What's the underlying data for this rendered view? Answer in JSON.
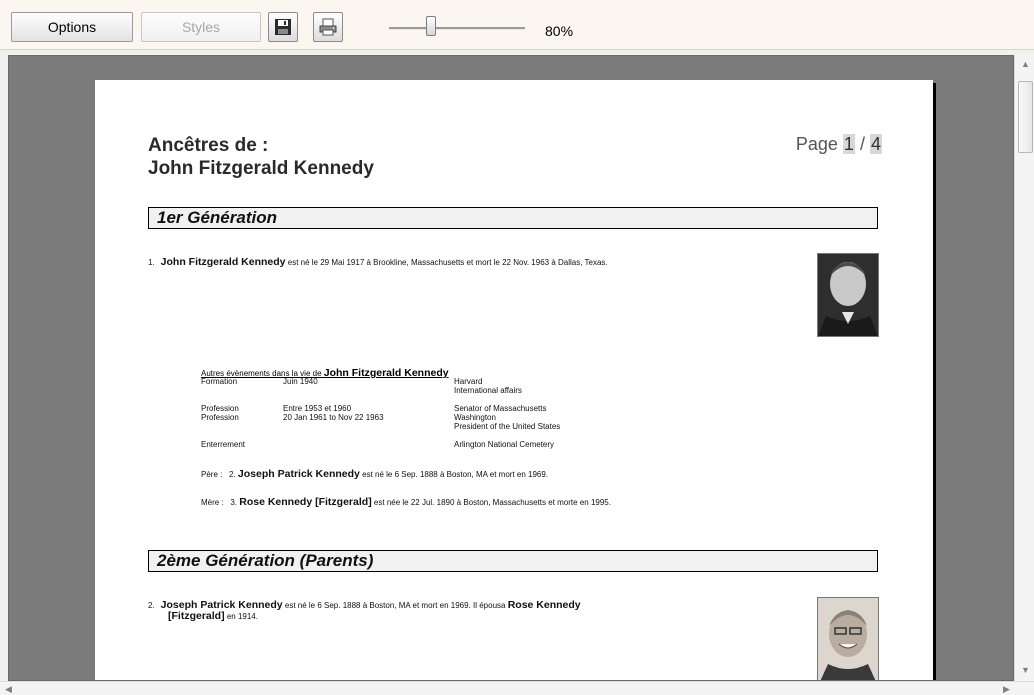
{
  "toolbar": {
    "options_label": "Options",
    "styles_label": "Styles",
    "zoom_value": "80%"
  },
  "document": {
    "title_line1": "Ancêtres de :",
    "title_line2": "John Fitzgerald Kennedy",
    "page_prefix": "Page",
    "page_current": "1",
    "page_sep": "/",
    "page_total": "4",
    "gen1_heading": "1er Génération",
    "gen2_heading": "2ème Génération (Parents)",
    "entry1": {
      "num": "1.",
      "name": "John Fitzgerald Kennedy",
      "text": "est né le 29 Mai 1917 à Brookline, Massachusetts et mort le 22 Nov. 1963 à Dallas, Texas."
    },
    "events": {
      "title_prefix": "Autres évènements dans la vie de",
      "title_name": "John Fitzgerald Kennedy",
      "rows": [
        {
          "type": "Formation",
          "date": "Juin 1940",
          "detail1": "Harvard",
          "detail2": "International affairs"
        },
        {
          "type": "Profession",
          "date": "Entre 1953 et 1960",
          "detail1": "Senator of Massachusetts",
          "detail2": ""
        },
        {
          "type": "Profession",
          "date": "20 Jan 1961 to Nov 22 1963",
          "detail1": "Washington",
          "detail2": "President of the United States"
        },
        {
          "type": "Enterrement",
          "date": "",
          "detail1": "Arlington National Cemetery",
          "detail2": ""
        }
      ]
    },
    "father": {
      "label": "Père :",
      "num": "2.",
      "name": "Joseph Patrick Kennedy",
      "text": "est né le 6 Sep. 1888 à Boston, MA et mort en 1969."
    },
    "mother": {
      "label": "Mère :",
      "num": "3.",
      "name": "Rose Kennedy [Fitzgerald]",
      "text": "est née le 22 Jul. 1890 à Boston, Massachusetts et morte en 1995."
    },
    "entry2": {
      "num": "2.",
      "name": "Joseph Patrick Kennedy",
      "text": "est né le 6 Sep. 1888 à Boston, MA et mort en 1969. Il épousa",
      "spouse": "Rose Kennedy",
      "spouse2": "[Fitzgerald]",
      "text2": "en 1914."
    }
  }
}
